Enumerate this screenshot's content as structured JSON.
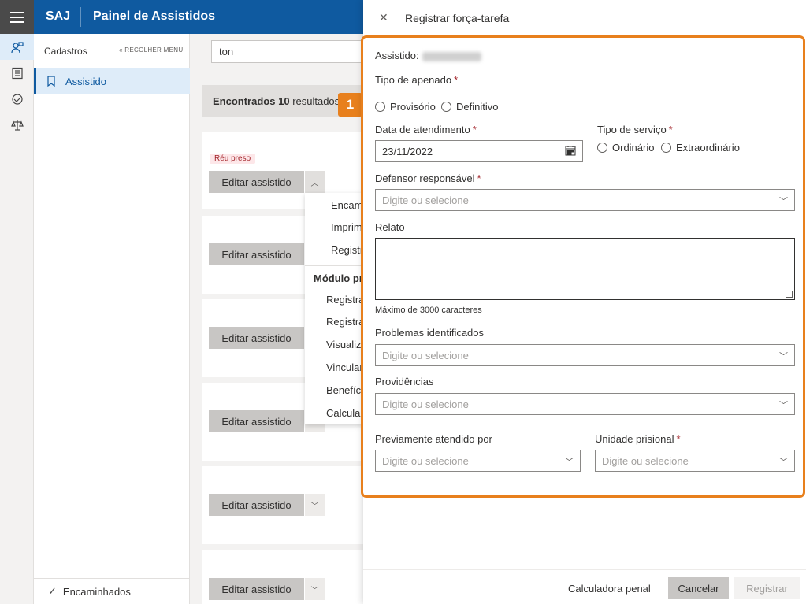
{
  "header": {
    "brand": "SAJ",
    "title": "Painel de Assistidos",
    "menu_icon": "hamburger-icon"
  },
  "rail": {
    "items": [
      {
        "icon": "person-search-icon",
        "active": true
      },
      {
        "icon": "list-icon",
        "active": false
      },
      {
        "icon": "handshake-icon",
        "active": false
      },
      {
        "icon": "scales-icon",
        "active": false
      }
    ]
  },
  "nav": {
    "heading": "Cadastros",
    "collapse_label": "RECOLHER MENU",
    "items": [
      {
        "label": "Assistido",
        "icon": "bookmark-icon"
      }
    ],
    "footer_label": "Encaminhados"
  },
  "content": {
    "search_value": "ton",
    "results_prefix": "Encontrados",
    "results_count": "10",
    "results_suffix": "resultados",
    "badge": "Réu preso",
    "edit_label": "Editar assistido",
    "dropdown": {
      "items_top": [
        "Encam",
        "Imprim",
        "Registr"
      ],
      "section": "Módulo pr",
      "items_bottom": [
        "Registra",
        "Registra",
        "Visualiz",
        "Vincular",
        "Benefíci",
        "Calcula"
      ]
    }
  },
  "marker": "1",
  "panel": {
    "title": "Registrar força-tarefa",
    "assistido_label": "Assistido:",
    "tipo_apenado": {
      "label": "Tipo de apenado",
      "required": "*",
      "options": [
        "Provisório",
        "Definitivo"
      ]
    },
    "data_atendimento": {
      "label": "Data de atendimento",
      "required": "*",
      "value": "23/11/2022"
    },
    "tipo_servico": {
      "label": "Tipo de serviço",
      "required": "*",
      "options": [
        "Ordinário",
        "Extraordinário"
      ]
    },
    "defensor": {
      "label": "Defensor responsável",
      "required": "*",
      "placeholder": "Digite ou selecione"
    },
    "relato": {
      "label": "Relato",
      "hint": "Máximo de 3000 caracteres"
    },
    "problemas": {
      "label": "Problemas identificados",
      "placeholder": "Digite ou selecione"
    },
    "providencias": {
      "label": "Providências",
      "placeholder": "Digite ou selecione"
    },
    "previamente": {
      "label": "Previamente atendido por",
      "placeholder": "Digite ou selecione"
    },
    "unidade": {
      "label": "Unidade prisional",
      "required": "*",
      "placeholder": "Digite ou selecione"
    },
    "footer": {
      "calc_label": "Calculadora penal",
      "cancel_label": "Cancelar",
      "submit_label": "Registrar"
    }
  },
  "colors": {
    "primary": "#0f5aa0",
    "highlight": "#e8801d",
    "required": "#a4262c"
  }
}
